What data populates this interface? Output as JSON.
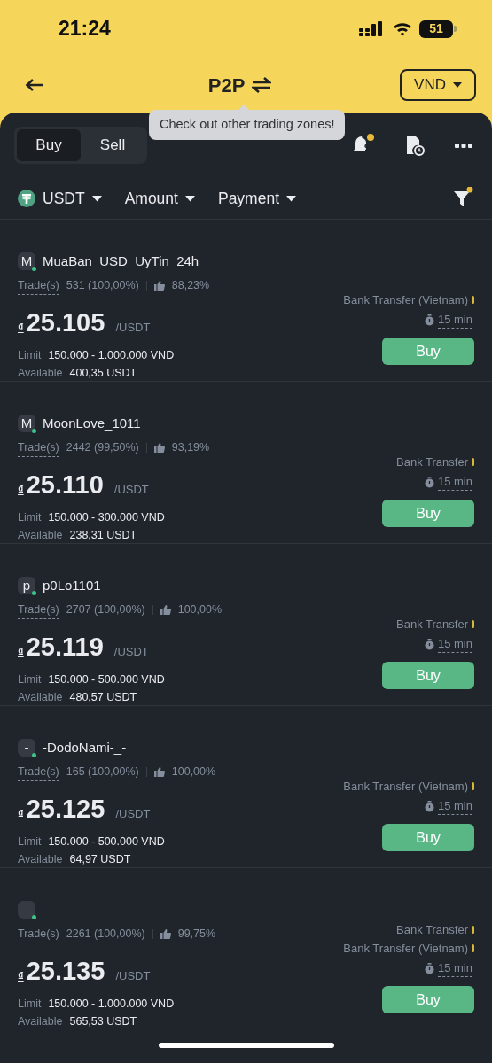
{
  "status_bar": {
    "time": "21:24",
    "battery": "51"
  },
  "header": {
    "title": "P2P",
    "currency": "VND"
  },
  "tooltip": "Check out other trading zones!",
  "tabs": [
    {
      "label": "Buy",
      "selected": true
    },
    {
      "label": "Sell",
      "selected": false
    }
  ],
  "filters": [
    {
      "kind": "coin",
      "label": "USDT"
    },
    {
      "kind": "dropdown",
      "label": "Amount"
    },
    {
      "kind": "dropdown",
      "label": "Payment"
    }
  ],
  "ads": [
    {
      "avatar_letter": "M",
      "name": "MuaBan_USD_UyTin_24h",
      "trades_label": "Trade(s)",
      "trades": "531 (100,00%)",
      "rating": "88,23%",
      "currency_symbol": "₫",
      "price": "25.105",
      "unit": "/USDT",
      "limit_label": "Limit",
      "limit": "150.000 - 1.000.000 VND",
      "available_label": "Available",
      "available": "400,35 USDT",
      "payments": [
        "Bank Transfer (Vietnam)"
      ],
      "time": "15 min",
      "button": "Buy"
    },
    {
      "avatar_letter": "M",
      "name": "MoonLove_1011",
      "trades_label": "Trade(s)",
      "trades": "2442 (99,50%)",
      "rating": "93,19%",
      "currency_symbol": "₫",
      "price": "25.110",
      "unit": "/USDT",
      "limit_label": "Limit",
      "limit": "150.000 - 300.000 VND",
      "available_label": "Available",
      "available": "238,31 USDT",
      "payments": [
        "Bank Transfer"
      ],
      "time": "15 min",
      "button": "Buy"
    },
    {
      "avatar_letter": "p",
      "name": "p0Lo1101",
      "trades_label": "Trade(s)",
      "trades": "2707 (100,00%)",
      "rating": "100,00%",
      "currency_symbol": "₫",
      "price": "25.119",
      "unit": "/USDT",
      "limit_label": "Limit",
      "limit": "150.000 - 500.000 VND",
      "available_label": "Available",
      "available": "480,57 USDT",
      "payments": [
        "Bank Transfer"
      ],
      "time": "15 min",
      "button": "Buy"
    },
    {
      "avatar_letter": "-",
      "name": "-DodoNami-_-",
      "trades_label": "Trade(s)",
      "trades": "165 (100,00%)",
      "rating": "100,00%",
      "currency_symbol": "₫",
      "price": "25.125",
      "unit": "/USDT",
      "limit_label": "Limit",
      "limit": "150.000 - 500.000 VND",
      "available_label": "Available",
      "available": "64,97 USDT",
      "payments": [
        "Bank Transfer (Vietnam)"
      ],
      "time": "15 min",
      "button": "Buy"
    },
    {
      "trades_label": "Trade(s)",
      "trades": "2261 (100,00%)",
      "rating": "99,75%",
      "currency_symbol": "₫",
      "price": "25.135",
      "unit": "/USDT",
      "limit_label": "Limit",
      "limit": "150.000 - 1.000.000 VND",
      "available_label": "Available",
      "available": "565,53 USDT",
      "payments": [
        "Bank Transfer",
        "Bank Transfer (Vietnam)"
      ],
      "time": "15 min",
      "button": "Buy"
    }
  ]
}
